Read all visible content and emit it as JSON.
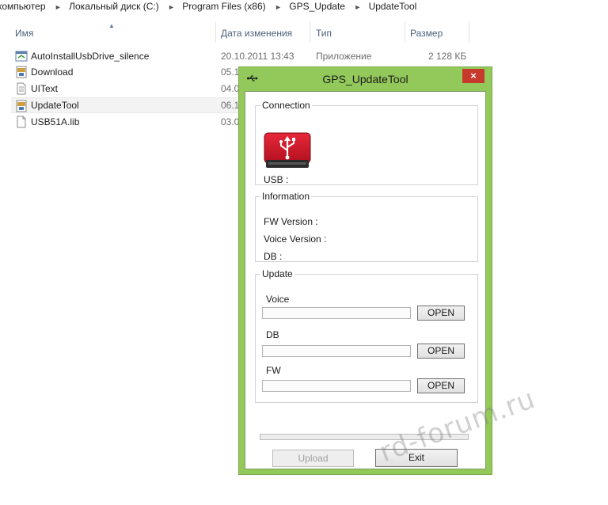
{
  "explorer": {
    "breadcrumb": [
      "компьютер",
      "Локальный диск (C:)",
      "Program Files (x86)",
      "GPS_Update",
      "UpdateTool"
    ],
    "columns": {
      "name": "Имя",
      "date": "Дата изменения",
      "type": "Тип",
      "size": "Размер"
    },
    "files": [
      {
        "name": "AutoInstallUsbDrive_silence",
        "date": "20.10.2011 13:43",
        "type": "Приложение",
        "size": "2 128 КБ",
        "icon": "application-icon"
      },
      {
        "name": "Download",
        "date": "05.1",
        "type": "",
        "size": "",
        "icon": "ini-file-icon"
      },
      {
        "name": "UIText",
        "date": "04.0",
        "type": "",
        "size": "",
        "icon": "text-file-icon"
      },
      {
        "name": "UpdateTool",
        "date": "06.1",
        "type": "",
        "size": "",
        "icon": "ini-file-icon"
      },
      {
        "name": "USB51A.lib",
        "date": "03.0",
        "type": "",
        "size": "",
        "icon": "blank-file-icon"
      }
    ]
  },
  "dialog": {
    "title": "GPS_UpdateTool",
    "close": "×",
    "connection": {
      "legend": "Connection",
      "usb_label": "USB :"
    },
    "information": {
      "legend": "Information",
      "fw_label": "FW Version :",
      "voice_label": "Voice Version :",
      "db_label": "DB :"
    },
    "update": {
      "legend": "Update",
      "voice_label": "Voice",
      "voice_value": "",
      "voice_open": "OPEN",
      "db_label": "DB",
      "db_value": "",
      "db_open": "OPEN",
      "fw_label": "FW",
      "fw_value": "",
      "fw_open": "OPEN"
    },
    "progress": 0,
    "upload_label": "Upload",
    "exit_label": "Exit"
  },
  "watermark": "rd-forum.ru",
  "colors": {
    "dialog_frame": "#93c95a",
    "close_button": "#c7382d",
    "usb_drive": "#d0182a"
  }
}
